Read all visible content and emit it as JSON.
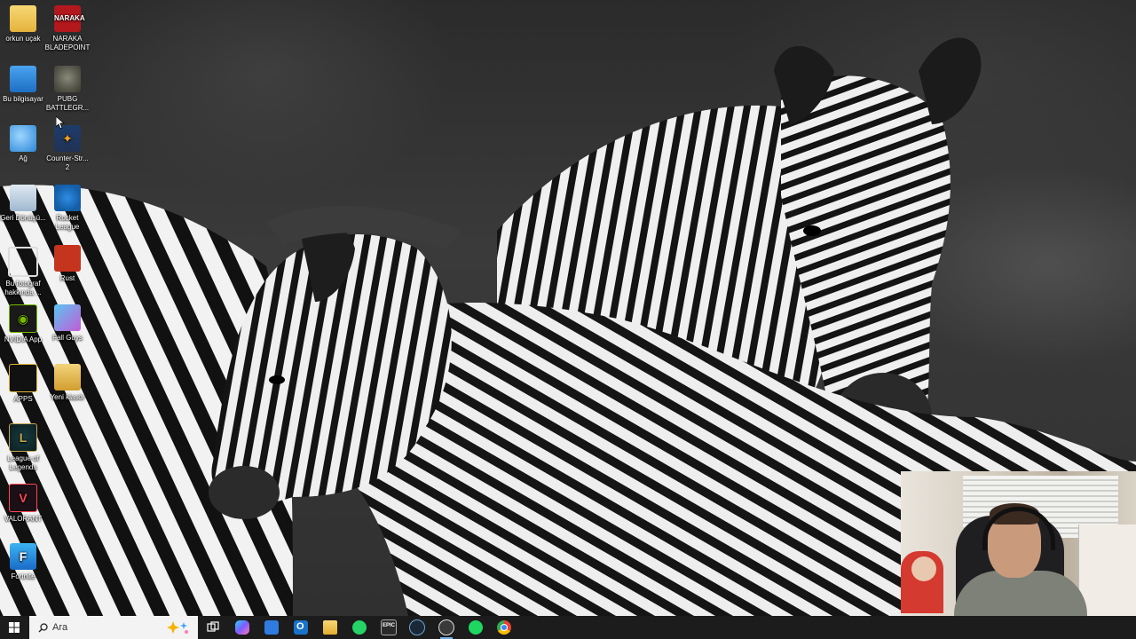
{
  "desktop": {
    "icons": [
      {
        "label": "orkun uçak",
        "icon": "user-folder-icon"
      },
      {
        "label": "NARAKA BLADEPOINT",
        "icon": "naraka-icon"
      },
      {
        "label": "Bu bilgisayar",
        "icon": "this-pc-icon"
      },
      {
        "label": "PUBG BATTLEGR...",
        "icon": "pubg-icon"
      },
      {
        "label": "Ağ",
        "icon": "network-icon"
      },
      {
        "label": "Counter-Str... 2",
        "icon": "counter-strike-icon"
      },
      {
        "label": "Geri Dönüşü...",
        "icon": "recycle-bin-icon"
      },
      {
        "label": "Rocket League",
        "icon": "rocket-league-icon"
      },
      {
        "label": "Bu fotoğraf hakkında ...",
        "icon": "about-photo-icon"
      },
      {
        "label": "Rust",
        "icon": "rust-icon"
      },
      {
        "label": "NVIDIA App",
        "icon": "nvidia-icon"
      },
      {
        "label": "Fall Guys",
        "icon": "fall-guys-icon"
      },
      {
        "label": "APPS",
        "icon": "apps-folder-icon"
      },
      {
        "label": "Yeni klasör",
        "icon": "new-folder-icon"
      },
      {
        "label": "League of Legends",
        "icon": "league-of-legends-icon"
      },
      {
        "label": "VALORANT",
        "icon": "valorant-icon"
      },
      {
        "label": "Fortnite",
        "icon": "fortnite-icon"
      }
    ]
  },
  "taskbar": {
    "search_placeholder": "Ara",
    "apps": [
      {
        "name": "task-view-icon",
        "color": "#ffffff"
      },
      {
        "name": "copilot-icon",
        "color": "#7b5cff"
      },
      {
        "name": "microsoft-store-icon",
        "color": "#2f7be0"
      },
      {
        "name": "outlook-icon",
        "color": "#1a73c9"
      },
      {
        "name": "file-explorer-icon",
        "color": "#f4c542"
      },
      {
        "name": "whatsapp-icon",
        "color": "#25d366"
      },
      {
        "name": "epic-games-icon",
        "color": "#2a2a2a"
      },
      {
        "name": "steam-icon",
        "color": "#1b2838"
      },
      {
        "name": "obs-icon",
        "color": "#3a3a3a"
      },
      {
        "name": "spotify-icon",
        "color": "#1ed760"
      },
      {
        "name": "chrome-icon",
        "color": "#4285f4"
      }
    ]
  },
  "colors": {
    "taskbar_bg": "#1c1c1c",
    "search_bg": "#f3f3f3"
  }
}
